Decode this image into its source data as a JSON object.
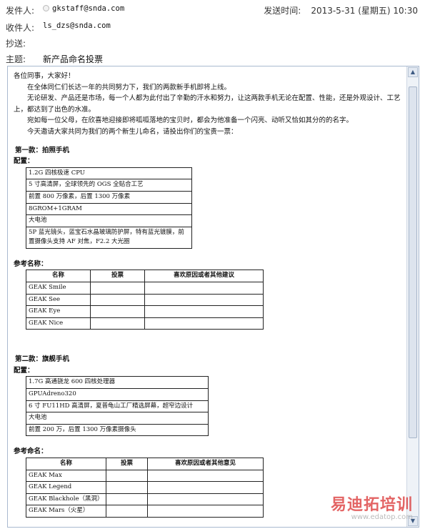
{
  "header": {
    "from_label": "发件人:",
    "from_value": "gkstaff@snda.com",
    "send_time_label": "发送时间:",
    "send_time_value": "2013-5-31 (星期五) 10:30",
    "to_label": "收件人:",
    "to_value": "ls_dzs@snda.com",
    "cc_label": "抄送:",
    "cc_value": "",
    "subject_label": "主题:",
    "subject_value": "新产品命名投票"
  },
  "body": {
    "greeting": "各位同事，大家好！",
    "p1": "在全体同仁们长达一年的共同努力下，我们的两款新手机即将上线。",
    "p2": "无论研发、产品还是市场，每一个人都为此付出了辛勤的汗水和努力，让这两款手机无论在配置、性能，还是外观设计、工艺上，都达到了出色的水准。",
    "p3": "宛如每一位父母，在欣喜地迎接即将呱呱落地的宝贝时，都会为他准备一个闪亮、动听又恰如其分的的名字。",
    "p4": "今天邀请大家共同为我们的两个新生儿命名，请投出你们的宝贵一票："
  },
  "phone1": {
    "title": "第一款：拍照手机",
    "config_label": "配置：",
    "specs": [
      "1.2G 四核极速 CPU",
      "5 寸高清屏，全球领先的 OGS 全贴合工艺",
      "前置 800 万像素，后置 1300 万像素",
      "8GROM+1GRAM",
      "大电池",
      "5P 蓝光镜头，蓝宝石水晶玻璃防护屏，特有蓝光镀膜，前置摄像头支持 AF 对焦，F2.2 大光圈"
    ],
    "names_label": "参考名称：",
    "table_headers": [
      "名称",
      "投票",
      "喜欢原因或者其他建议"
    ],
    "names": [
      "GEAK Smile",
      "GEAK See",
      "GEAK Eye",
      "GEAK Nice"
    ]
  },
  "phone2": {
    "title": "第二款：旗舰手机",
    "config_label": "配置：",
    "specs": [
      "1.7G 高通骁龙 600 四核处理器",
      "GPUAdreno320",
      "6 寸 FU11HD 高清屏，夏普龟山工厂精选屏幕，超窄边设计",
      "大电池",
      "前置 200 万，后置 1300 万像素摄像头"
    ],
    "names_label": "参考命名：",
    "table_headers": [
      "名称",
      "投票",
      "喜欢原因或者其他意见"
    ],
    "names": [
      "GEAK Max",
      "GEAK Legend",
      "GEAK Blackhole（黑洞）",
      "GEAK Mars（火星）"
    ]
  },
  "scrollbar": {
    "up_icon": "▲",
    "down_icon": "▼"
  },
  "watermark": {
    "main": "易迪拓培训",
    "sub": "www.edatop.com"
  }
}
